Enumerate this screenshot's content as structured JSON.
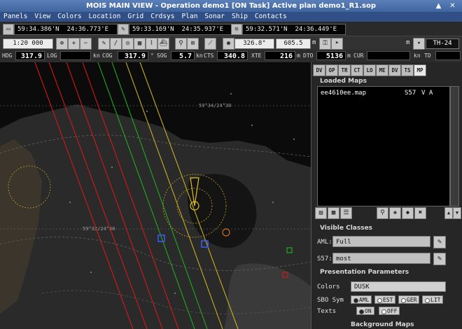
{
  "window": {
    "title": "MOIS MAIN VIEW - Operation demo1 [ON Task]   Active plan demo1_R1.sop",
    "controls": [
      "▲",
      "✕"
    ]
  },
  "menu": [
    "Panels",
    "View",
    "Colors",
    "Location",
    "Grid",
    "Crdsys",
    "Plan",
    "Sonar",
    "Ship",
    "Contacts"
  ],
  "positions": [
    "59:34.386'N  24:36.773'E",
    "59:33.169'N  24:35.937'E",
    "59:32.571'N  24:36.449'E"
  ],
  "toolbar": {
    "scale": "1:20 000",
    "bearing": "326.8°",
    "distance": "605.5",
    "distance_unit": "m",
    "m_label": "m",
    "ship": "TH-24"
  },
  "nav": {
    "hdg_label": "HDG",
    "hdg": "317.9",
    "log_label": "LOG",
    "log_unit": "kn",
    "cog_label": "COG",
    "cog": "317.9",
    "deg": "°",
    "sog_label": "SOG",
    "sog": "5.7",
    "sog_unit": "kn",
    "cts_label": "CTS",
    "cts": "340.8",
    "xte_label": "XTE",
    "xte": "216",
    "xte_unit": "m",
    "dto_label": "DTO",
    "dto": "5136",
    "dto_unit": "m",
    "cur_label": "CUR",
    "kn": "kn",
    "td_label": "TD"
  },
  "panel": {
    "tabs": [
      "DV",
      "OP",
      "TR",
      "CT",
      "LO",
      "ME",
      "DV",
      "TS",
      "MP"
    ],
    "active_tab": "MP",
    "loaded_maps_title": "Loaded Maps",
    "loaded_maps": [
      {
        "name": "ee4610ee.map",
        "type": "S57",
        "flags": "V A"
      }
    ],
    "visible_classes_title": "Visible Classes",
    "aml_label": "AML:",
    "aml_value": "Full",
    "s57_label": "S57:",
    "s57_value": "most",
    "presentation_title": "Presentation Parameters",
    "colors_label": "Colors",
    "colors_value": "DUSK",
    "sbo_label": "SBO Sym",
    "sbo_options": [
      "AML",
      "EST",
      "GER",
      "LIT"
    ],
    "sbo_selected": "AML",
    "texts_label": "Texts",
    "texts_options": [
      "ON",
      "OFF"
    ],
    "texts_selected": "ON",
    "background_title": "Background Maps"
  },
  "map": {
    "labels": [
      "59°34/24°30",
      "59°33/24°30"
    ],
    "colors": {
      "red": "#d11a1a",
      "green": "#1faa1f",
      "yellow": "#c7b020",
      "land": "#3b352b",
      "shallow": "#2b2b2b"
    }
  }
}
